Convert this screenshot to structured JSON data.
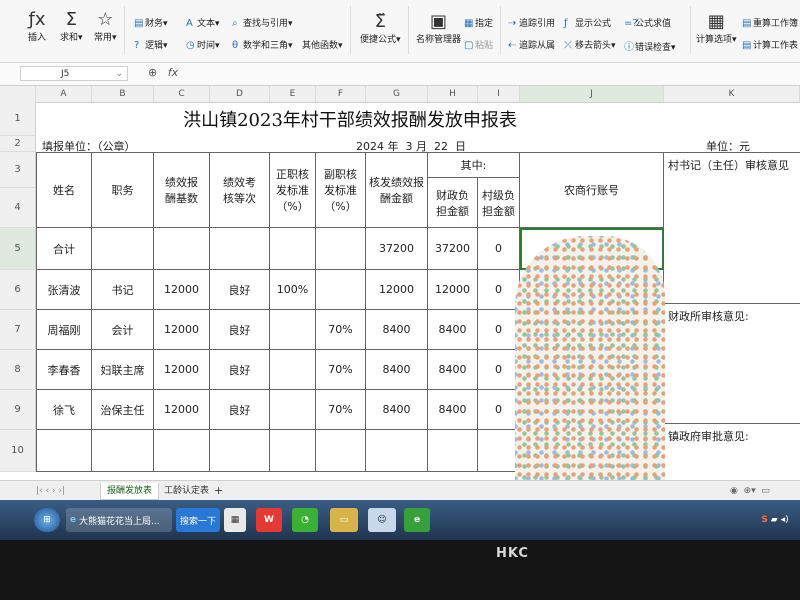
{
  "ribbon": {
    "insert_fn": "插入",
    "sum": "求和",
    "common": "常用",
    "finance": "财务",
    "text": "文本",
    "lookup": "查找与引用",
    "logic": "逻辑",
    "time": "时间",
    "math": "数学和三角",
    "other_fn": "其他函数",
    "quick_formula": "便捷公式",
    "name_manager": "名称管理器",
    "assign": "指定",
    "paste": "粘贴",
    "trace_precedents": "追踪引用",
    "trace_dependents": "追踪从属",
    "show_formula": "显示公式",
    "remove_arrows": "移去箭头",
    "eval_formula": "公式求值",
    "error_check": "错误检查",
    "calc_options": "计算选项",
    "recalc_book": "重算工作簿",
    "calc_sheet": "计算工作表"
  },
  "formula_bar": {
    "cell_ref": "J5",
    "fx": "fx"
  },
  "columns": [
    "A",
    "B",
    "C",
    "D",
    "E",
    "F",
    "G",
    "H",
    "I",
    "J",
    "K"
  ],
  "rows": [
    "1",
    "2",
    "3",
    "4",
    "5",
    "6",
    "7",
    "8",
    "9",
    "10"
  ],
  "title": "洪山镇2023年村干部绩效报酬发放申报表",
  "row2": {
    "unit_label": "填报单位：（公章）",
    "year": "2024",
    "year_unit": "年",
    "month": "3",
    "month_unit": "月",
    "day": "22",
    "day_unit": "日",
    "currency_unit": "单位：元"
  },
  "headers": {
    "name": "姓名",
    "position": "职务",
    "base": "绩效报酬基数",
    "grade": "绩效考核等次",
    "chief_std": "正职核发标准（%）",
    "deputy_std": "副职核发标准（%）",
    "amount": "核发绩效报酬金额",
    "among": "其中:",
    "fiscal": "财政负担金额",
    "village": "村级负担金额",
    "bank": "农商行账号",
    "secretary_review": "村书记（主任）审核意见",
    "finance_review": "财政所审核意见:",
    "town_approval": "镇政府审批意见:"
  },
  "table_rows": [
    {
      "name": "合计",
      "position": "",
      "base": "",
      "grade": "",
      "chief": "",
      "deputy": "",
      "amount": "37200",
      "fiscal": "37200",
      "village": "0"
    },
    {
      "name": "张清波",
      "position": "书记",
      "base": "12000",
      "grade": "良好",
      "chief": "100%",
      "deputy": "",
      "amount": "12000",
      "fiscal": "12000",
      "village": "0"
    },
    {
      "name": "周福刚",
      "position": "会计",
      "base": "12000",
      "grade": "良好",
      "chief": "",
      "deputy": "70%",
      "amount": "8400",
      "fiscal": "8400",
      "village": "0"
    },
    {
      "name": "李春香",
      "position": "妇联主席",
      "base": "12000",
      "grade": "良好",
      "chief": "",
      "deputy": "70%",
      "amount": "8400",
      "fiscal": "8400",
      "village": "0"
    },
    {
      "name": "徐飞",
      "position": "治保主任",
      "base": "12000",
      "grade": "良好",
      "chief": "",
      "deputy": "70%",
      "amount": "8400",
      "fiscal": "8400",
      "village": "0"
    }
  ],
  "tabs": {
    "active": "报酬发放表",
    "second": "工龄认定表",
    "add": "+"
  },
  "taskbar": {
    "item1": "大熊猫花花当上局...",
    "item2": "搜索一下"
  },
  "brand": "HKC"
}
